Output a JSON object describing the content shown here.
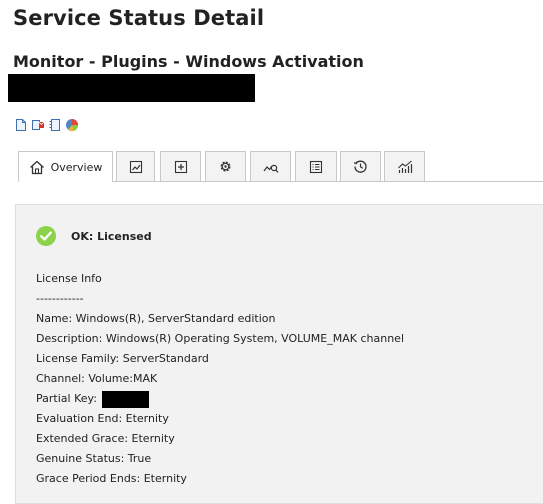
{
  "page": {
    "title": "Service Status Detail",
    "subtitle": "Monitor - Plugins - Windows Activation"
  },
  "action_icons": [
    "document-icon",
    "mail-icon",
    "notes-icon",
    "pie-chart-icon"
  ],
  "tabs": [
    {
      "label": "Overview",
      "icon": "home-icon",
      "active": true
    },
    {
      "label": "",
      "icon": "trend-chart-icon"
    },
    {
      "label": "",
      "icon": "add-box-icon"
    },
    {
      "label": "",
      "icon": "gear-icon"
    },
    {
      "label": "",
      "icon": "graph-search-icon"
    },
    {
      "label": "",
      "icon": "list-icon"
    },
    {
      "label": "",
      "icon": "history-icon"
    },
    {
      "label": "",
      "icon": "bar-trend-icon"
    }
  ],
  "status": {
    "text": "OK: Licensed",
    "icon": "check-circle-icon",
    "color": "#8cd24a"
  },
  "info": {
    "header": "License Info",
    "separator": "------------",
    "name": "Name: Windows(R), ServerStandard edition",
    "description": "Description: Windows(R) Operating System, VOLUME_MAK channel",
    "license_family": "License Family: ServerStandard",
    "channel": "Channel: Volume:MAK",
    "partial_key_label": "Partial Key:",
    "evaluation_end": "Evaluation End: Eternity",
    "extended_grace": "Extended Grace: Eternity",
    "genuine_status": "Genuine Status: True",
    "grace_period_ends": "Grace Period Ends: Eternity"
  }
}
